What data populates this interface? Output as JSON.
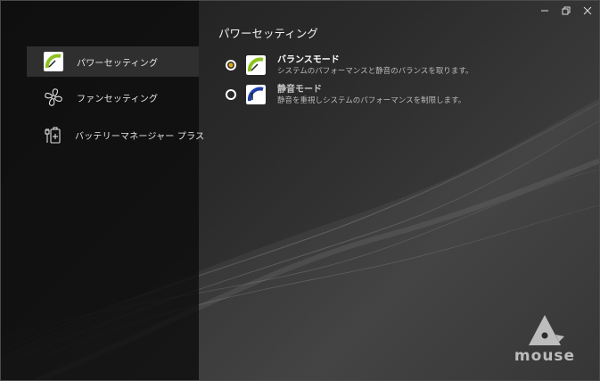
{
  "titlebar": {
    "minimize_icon": "minimize-icon",
    "restore_icon": "restore-icon",
    "close_icon": "close-icon"
  },
  "sidebar": {
    "items": [
      {
        "label": "パワーセッティング",
        "icon": "power-gauge-icon",
        "active": true
      },
      {
        "label": "ファンセッティング",
        "icon": "fan-icon",
        "active": false
      },
      {
        "label": "バッテリーマネージャー プラス",
        "icon": "battery-plug-icon",
        "active": false
      }
    ]
  },
  "main": {
    "title": "パワーセッティング",
    "modes": [
      {
        "title": "バランスモード",
        "description": "システムのパフォーマンスと静音のバランスを取ります。",
        "selected": true,
        "icon": "balance-gauge-icon"
      },
      {
        "title": "静音モード",
        "description": "静音を重視しシステムのパフォーマンスを制限します。",
        "selected": false,
        "icon": "quiet-gauge-icon"
      }
    ]
  },
  "logo": {
    "text": "mouse"
  },
  "colors": {
    "accent_green": "#8dc21f",
    "accent_blue": "#1e3fa8",
    "radio_selected": "#e0a81c"
  }
}
